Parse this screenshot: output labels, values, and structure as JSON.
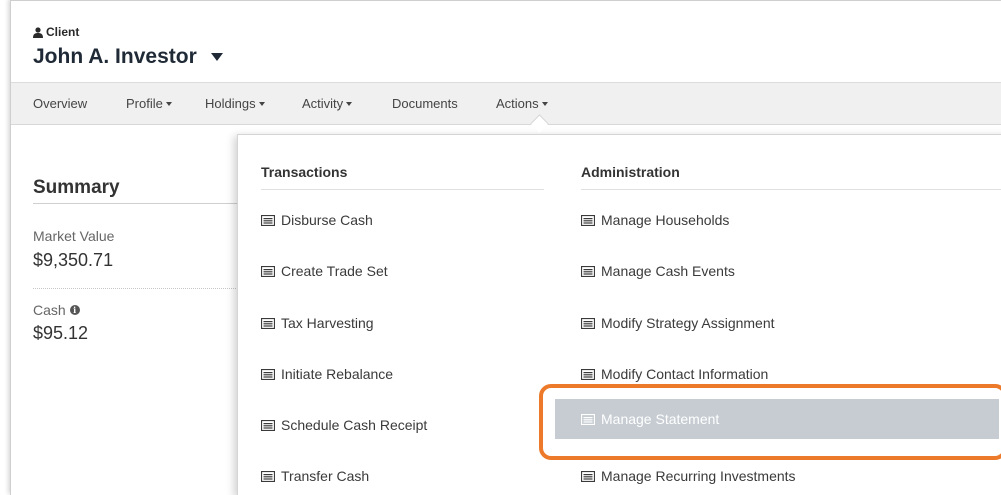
{
  "client": {
    "label": "Client",
    "name": "John A. Investor"
  },
  "nav": {
    "items": [
      {
        "label": "Overview",
        "has_dropdown": false
      },
      {
        "label": "Profile",
        "has_dropdown": true
      },
      {
        "label": "Holdings",
        "has_dropdown": true
      },
      {
        "label": "Activity",
        "has_dropdown": true
      },
      {
        "label": "Documents",
        "has_dropdown": false
      },
      {
        "label": "Actions",
        "has_dropdown": true
      }
    ],
    "open_menu": "Actions"
  },
  "summary": {
    "title": "Summary",
    "metrics": [
      {
        "label": "Market Value",
        "value": "$9,350.71"
      },
      {
        "label": "Cash",
        "value": "$95.12",
        "info_icon": "info-icon"
      }
    ]
  },
  "actions_menu": {
    "columns": [
      {
        "heading": "Transactions",
        "items": [
          {
            "label": "Disburse Cash",
            "icon": "list-icon"
          },
          {
            "label": "Create Trade Set",
            "icon": "list-icon"
          },
          {
            "label": "Tax Harvesting",
            "icon": "list-icon"
          },
          {
            "label": "Initiate Rebalance",
            "icon": "list-icon"
          },
          {
            "label": "Schedule Cash Receipt",
            "icon": "list-icon"
          },
          {
            "label": "Transfer Cash",
            "icon": "list-icon"
          }
        ]
      },
      {
        "heading": "Administration",
        "items": [
          {
            "label": "Manage Households",
            "icon": "list-icon"
          },
          {
            "label": "Manage Cash Events",
            "icon": "list-icon"
          },
          {
            "label": "Modify Strategy Assignment",
            "icon": "list-icon"
          },
          {
            "label": "Modify Contact Information",
            "icon": "list-icon"
          },
          {
            "label": "Manage Statement",
            "icon": "list-icon",
            "highlighted": true
          },
          {
            "label": "Manage Recurring Investments",
            "icon": "list-icon"
          }
        ]
      }
    ]
  },
  "colors": {
    "highlight_ring": "#ec7a2a",
    "active_item_bg": "#c6ccd2",
    "nav_bg": "#f0f0f0"
  }
}
